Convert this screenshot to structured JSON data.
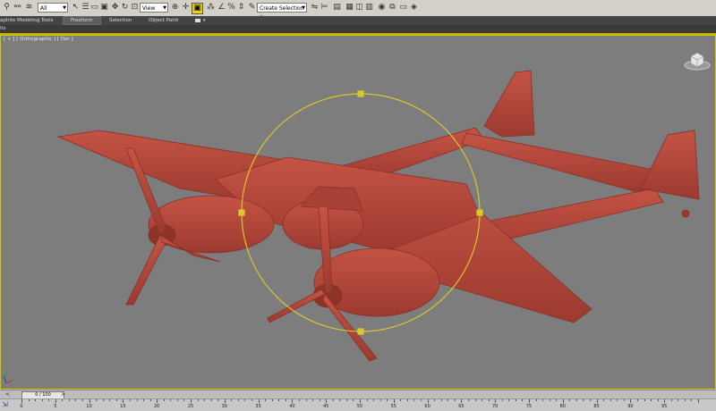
{
  "toolbar": {
    "filter_select": "All",
    "view_select": "View",
    "selection_set": "Create Selection Se"
  },
  "ribbon": {
    "title": "aphite Modeling Tools",
    "tabs": [
      "Freeform",
      "Selection",
      "Object Paint"
    ]
  },
  "ribbon2": {
    "label": "lts"
  },
  "viewport": {
    "label": "[ + ] [ Orthographic ] [ Dar ]"
  },
  "timeline": {
    "slider_label": "0 / 100"
  },
  "trackbar": {
    "ticks": [
      "0",
      "5",
      "10",
      "15",
      "20",
      "25",
      "30",
      "35",
      "40",
      "45",
      "50",
      "55",
      "60",
      "65",
      "70",
      "75",
      "80",
      "85",
      "90",
      "95"
    ]
  },
  "colors": {
    "model": "#b9473a",
    "gizmo": "#d8c82a",
    "viewport_bg": "#7d7d7d"
  }
}
